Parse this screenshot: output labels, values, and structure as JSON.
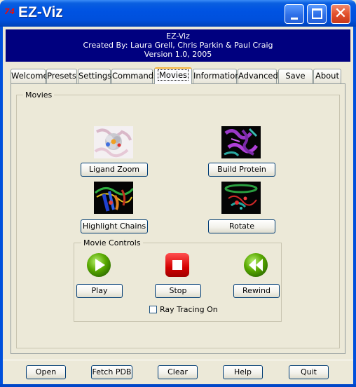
{
  "window": {
    "title": "EZ-Viz",
    "app_icon": "74"
  },
  "banner": {
    "line1": "EZ-Viz",
    "line2": "Created By: Laura Grell, Chris Parkin & Paul Craig",
    "line3": "Version 1.0, 2005"
  },
  "tabs": [
    {
      "label": "Welcome"
    },
    {
      "label": "Presets"
    },
    {
      "label": "Settings"
    },
    {
      "label": "Commands"
    },
    {
      "label": "Movies"
    },
    {
      "label": "Information"
    },
    {
      "label": "Advanced"
    },
    {
      "label": "Save"
    },
    {
      "label": "About"
    }
  ],
  "active_tab": "Movies",
  "movies": {
    "group_label": "Movies",
    "buttons": {
      "ligand_zoom": "Ligand Zoom",
      "build_protein": "Build Protein",
      "highlight_chains": "Highlight Chains",
      "rotate": "Rotate"
    }
  },
  "controls": {
    "group_label": "Movie Controls",
    "play": "Play",
    "stop": "Stop",
    "rewind": "Rewind",
    "ray_tracing_label": "Ray Tracing On",
    "ray_tracing_checked": false
  },
  "bottom": {
    "open": "Open",
    "fetch_pdb": "Fetch PDB",
    "clear": "Clear",
    "help": "Help",
    "quit": "Quit"
  },
  "colors": {
    "titlebar": "#0053e2",
    "banner_bg": "#00007f",
    "play_green": "#58a800",
    "stop_red": "#d40000",
    "active_tab_accent": "#f4b33a"
  },
  "icons": {
    "minimize": "minimize-icon",
    "maximize": "maximize-icon",
    "close": "close-icon",
    "play": "play-icon",
    "stop": "stop-icon",
    "rewind": "rewind-icon"
  }
}
